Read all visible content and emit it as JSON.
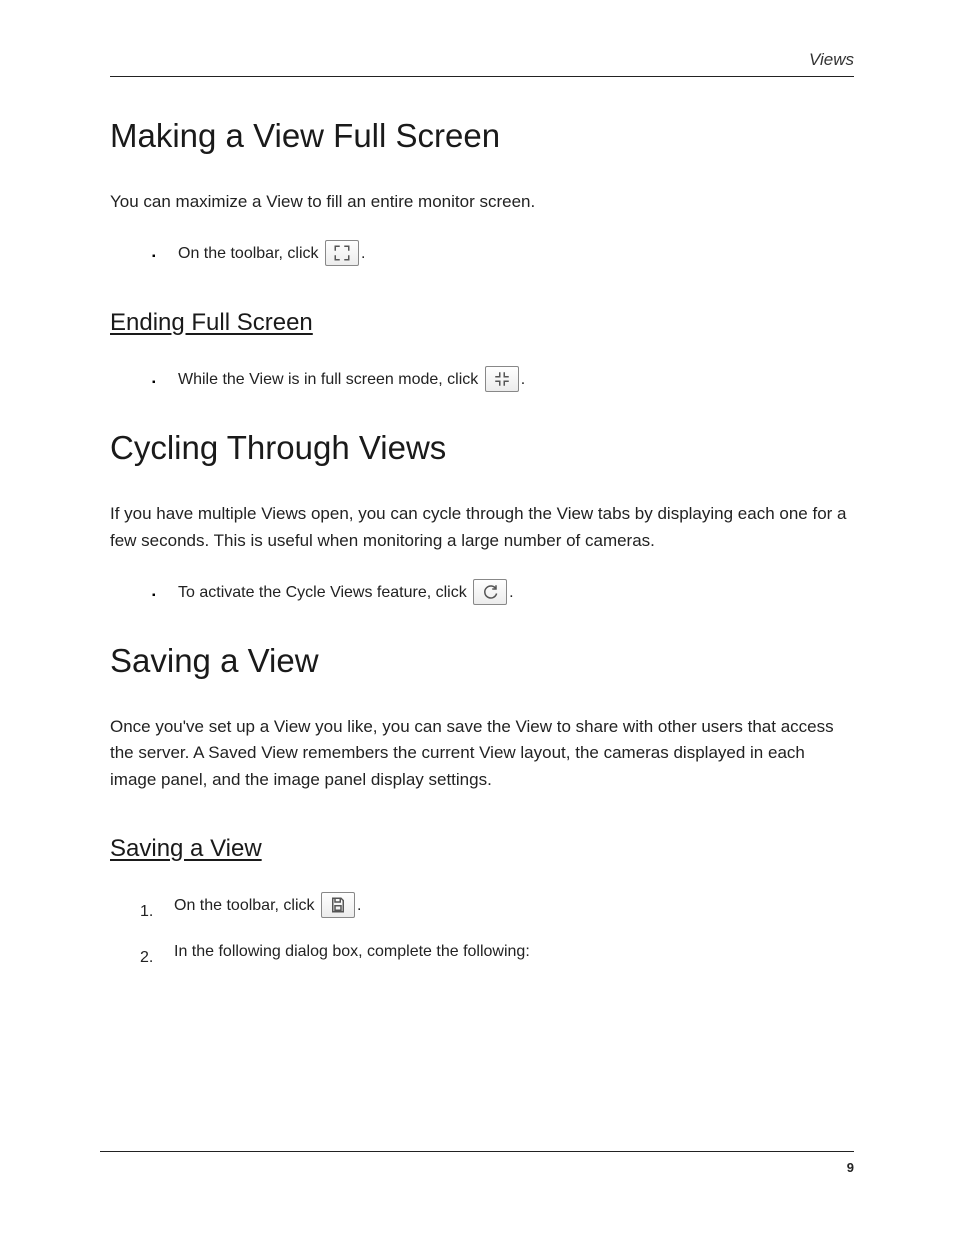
{
  "header": {
    "running_head": "Views"
  },
  "sections": [
    {
      "h1": "Making a View Full Screen",
      "intro": "You can maximize a View to fill an entire monitor screen.",
      "bullet1": {
        "pre": "On the toolbar, click ",
        "post": "."
      },
      "sub": {
        "h2": "Ending Full Screen",
        "bullet1": {
          "pre": "While the View is in full screen mode, click ",
          "post": "."
        }
      }
    },
    {
      "h1": "Cycling Through Views",
      "intro": "If you have multiple Views open, you can cycle through the View tabs by displaying each one for a few seconds. This is useful when monitoring a large number of cameras.",
      "bullet1": {
        "pre": "To activate the Cycle Views feature, click ",
        "post": "."
      }
    },
    {
      "h1": "Saving a View",
      "intro": "Once you've set up a View you like, you can save the View to share with other users that access the server. A Saved View remembers the current View layout, the cameras displayed in each image panel, and the image panel display settings.",
      "sub": {
        "h2": "Saving a View",
        "step1": {
          "pre": "On the toolbar, click ",
          "post": "."
        },
        "step2": "In the following dialog box, complete the following:"
      }
    }
  ],
  "footer": {
    "page_number": "9"
  }
}
